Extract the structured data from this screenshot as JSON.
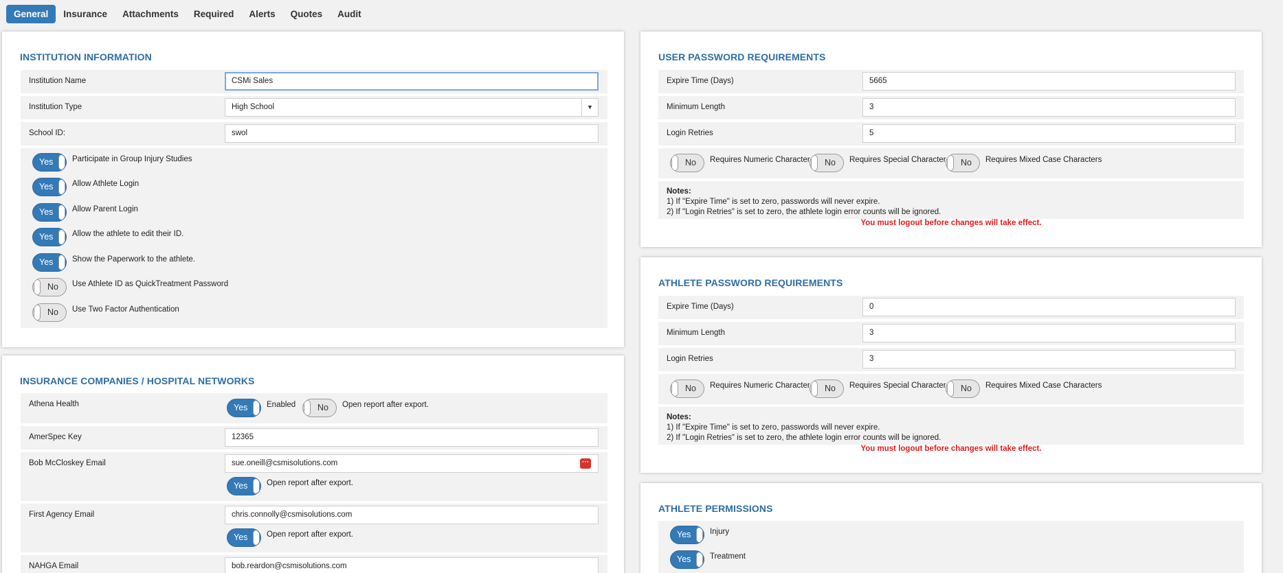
{
  "tabs": [
    "General",
    "Insurance",
    "Attachments",
    "Required",
    "Alerts",
    "Quotes",
    "Audit"
  ],
  "institution": {
    "title": "INSTITUTION INFORMATION",
    "name_label": "Institution Name",
    "name_value": "CSMi Sales",
    "type_label": "Institution Type",
    "type_value": "High School",
    "school_id_label": "School ID:",
    "school_id_value": "swol",
    "toggles": [
      {
        "state": "Yes",
        "label": "Participate in Group Injury Studies"
      },
      {
        "state": "Yes",
        "label": "Allow Athlete Login"
      },
      {
        "state": "Yes",
        "label": "Allow Parent Login"
      },
      {
        "state": "Yes",
        "label": "Allow the athlete to edit their ID."
      },
      {
        "state": "Yes",
        "label": "Show the Paperwork to the athlete."
      },
      {
        "state": "No",
        "label": "Use Athlete ID as QuickTreatment Password"
      },
      {
        "state": "No",
        "label": "Use Two Factor Authentication"
      }
    ]
  },
  "insurance": {
    "title": "INSURANCE COMPANIES / HOSPITAL NETWORKS",
    "athena_label": "Athena Health",
    "athena_enabled_state": "Yes",
    "athena_enabled_label": "Enabled",
    "athena_open_state": "No",
    "athena_open_label": "Open report after export.",
    "amerspec_label": "AmerSpec Key",
    "amerspec_value": "12365",
    "bob_label": "Bob McCloskey Email",
    "bob_value": "sue.oneill@csmisolutions.com",
    "bob_open_state": "Yes",
    "bob_open_label": "Open report after export.",
    "first_label": "First Agency Email",
    "first_value": "chris.connolly@csmisolutions.com",
    "first_open_state": "Yes",
    "first_open_label": "Open report after export.",
    "nahga_label": "NAHGA Email",
    "nahga_value": "bob.reardon@csmisolutions.com"
  },
  "user_pw": {
    "title": "USER PASSWORD REQUIREMENTS",
    "expire_label": "Expire Time (Days)",
    "expire_value": "5665",
    "minlen_label": "Minimum Length",
    "minlen_value": "3",
    "retries_label": "Login Retries",
    "retries_value": "5",
    "numeric_state": "No",
    "numeric_label": "Requires Numeric Character",
    "special_state": "No",
    "special_label": "Requires Special Character",
    "mixed_state": "No",
    "mixed_label": "Requires Mixed Case Characters",
    "notes_title": "Notes:",
    "note1": "1) If \"Expire Time\" is set to zero, passwords will never expire.",
    "note2": "2) If \"Login Retries\" is set to zero, the athlete login error counts will be ignored.",
    "warning": "You must logout before changes will take effect."
  },
  "athlete_pw": {
    "title": "ATHLETE PASSWORD REQUIREMENTS",
    "expire_label": "Expire Time (Days)",
    "expire_value": "0",
    "minlen_label": "Minimum Length",
    "minlen_value": "3",
    "retries_label": "Login Retries",
    "retries_value": "3",
    "numeric_state": "No",
    "numeric_label": "Requires Numeric Character",
    "special_state": "No",
    "special_label": "Requires Special Character",
    "mixed_state": "No",
    "mixed_label": "Requires Mixed Case Characters",
    "notes_title": "Notes:",
    "note1": "1) If \"Expire Time\" is set to zero, passwords will never expire.",
    "note2": "2) If \"Login Retries\" is set to zero, the athlete login error counts will be ignored.",
    "warning": "You must logout before changes will take effect."
  },
  "athlete_perm": {
    "title": "ATHLETE PERMISSIONS",
    "injury_state": "Yes",
    "injury_label": "Injury",
    "treatment_state": "Yes",
    "treatment_label": "Treatment"
  },
  "icons": {
    "contact": "contact-card-icon",
    "dropdown": "chevron-down-icon"
  },
  "colors": {
    "accent": "#337ab7",
    "title": "#2e6da4",
    "warning": "#e31b1b"
  }
}
